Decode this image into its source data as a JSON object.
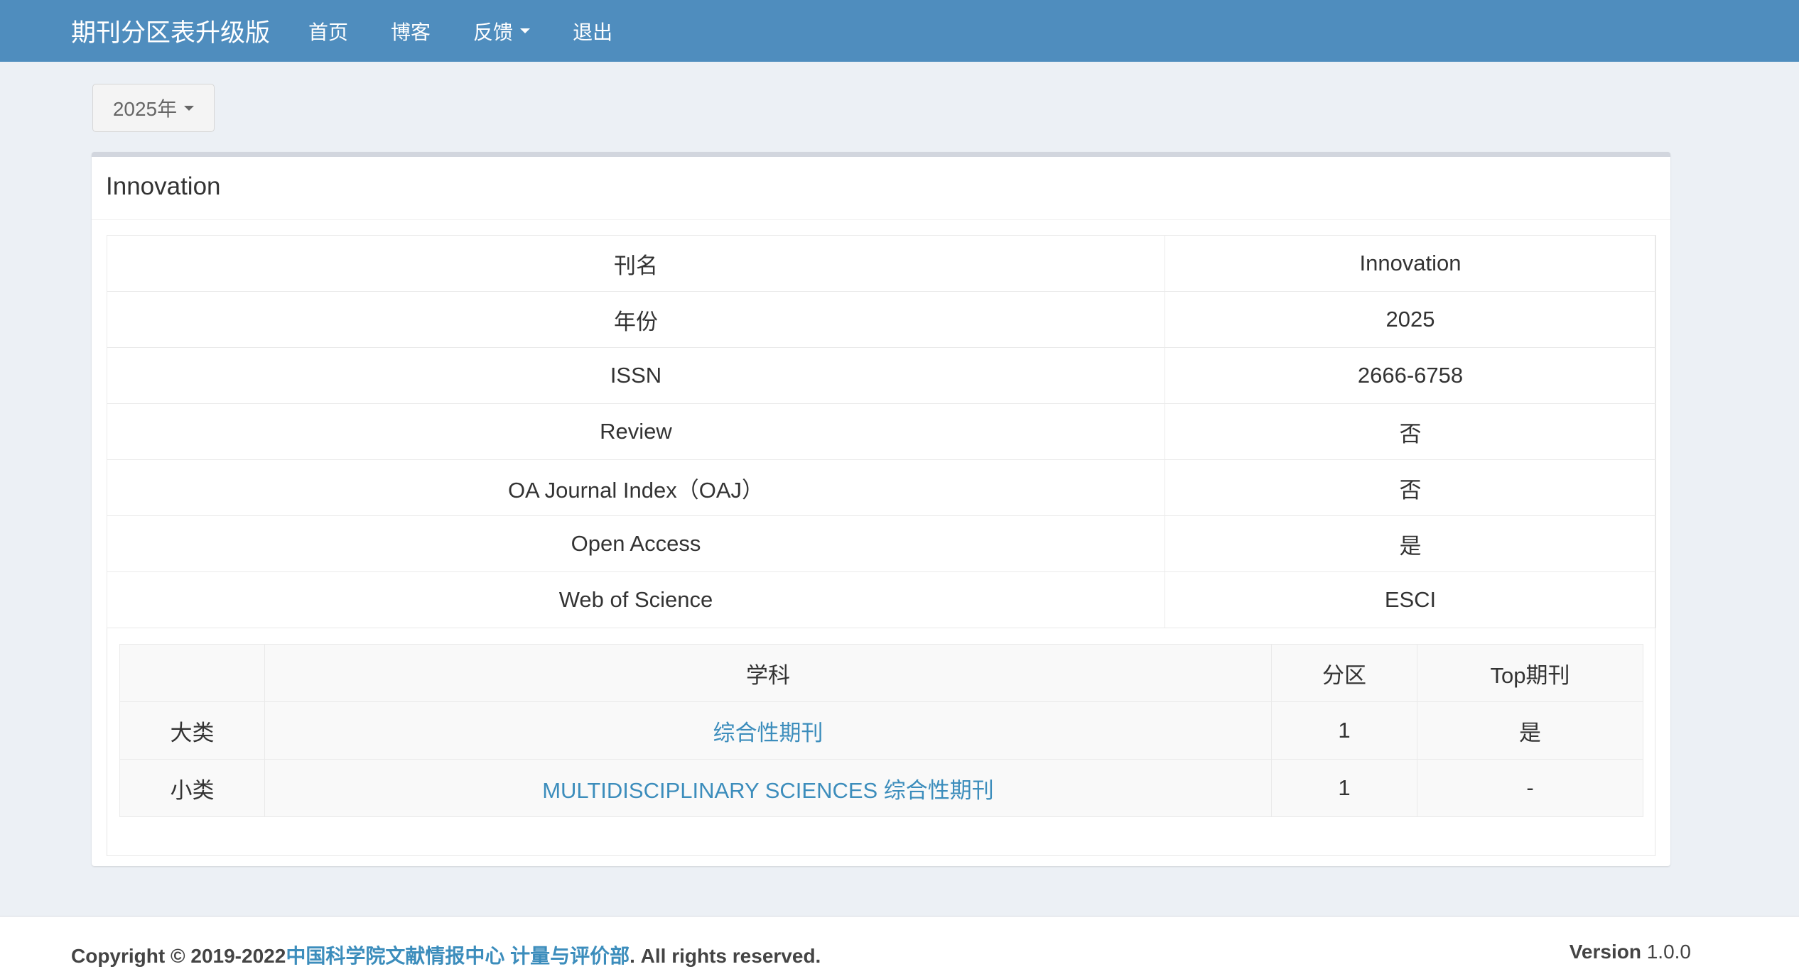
{
  "navbar": {
    "brand": "期刊分区表升级版",
    "items": [
      {
        "label": "首页"
      },
      {
        "label": "博客"
      },
      {
        "label": "反馈"
      },
      {
        "label": "退出"
      }
    ]
  },
  "year_selector": {
    "label": "2025年"
  },
  "journal": {
    "title": "Innovation",
    "info_rows": [
      {
        "label": "刊名",
        "value": "Innovation"
      },
      {
        "label": "年份",
        "value": "2025"
      },
      {
        "label": "ISSN",
        "value": "2666-6758"
      },
      {
        "label": "Review",
        "value": "否"
      },
      {
        "label": "OA Journal Index（OAJ）",
        "value": "否"
      },
      {
        "label": "Open Access",
        "value": "是"
      },
      {
        "label": "Web of Science",
        "value": "ESCI"
      }
    ],
    "subject_table": {
      "headers": [
        "",
        "学科",
        "分区",
        "Top期刊"
      ],
      "rows": [
        {
          "type": "大类",
          "subject": "综合性期刊",
          "zone": "1",
          "top": "是"
        },
        {
          "type": "小类",
          "subject": "MULTIDISCIPLINARY SCIENCES 综合性期刊",
          "zone": "1",
          "top": "-"
        }
      ]
    }
  },
  "footer": {
    "copyright_prefix": "Copyright © 2019-2022",
    "org_link": "中国科学院文献情报中心 计量与评价部",
    "rights": ". All rights reserved.",
    "version_label": "Version",
    "version_number": "1.0.0"
  },
  "colors": {
    "navbar": "#4f8dbe",
    "link": "#3c8dbc",
    "background": "#ecf0f5"
  }
}
